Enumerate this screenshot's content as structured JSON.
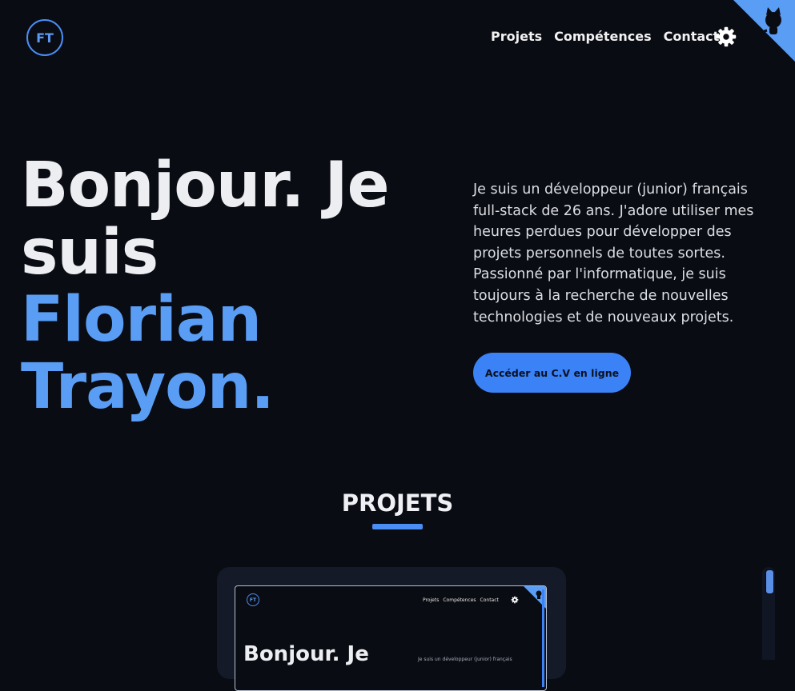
{
  "header": {
    "logo_text": "FT",
    "nav": [
      {
        "label": "Projets"
      },
      {
        "label": "Compétences"
      },
      {
        "label": "Contact"
      }
    ],
    "settings_icon": "gear-icon",
    "github_icon": "github-octocat-icon",
    "accent_color": "#3b82f6"
  },
  "hero": {
    "line1": "Bonjour. Je",
    "line2": "suis",
    "name_line1": "Florian",
    "name_line2": "Trayon.",
    "intro": "Je suis un développeur (junior) français full-stack de 26 ans. J'adore utiliser mes heures perdues pour développer des projets personnels de toutes sortes. Passionné par l'informatique, je suis toujours à la recherche de nouvelles technologies et de nouveaux projets.",
    "cv_button": "Accéder au C.V en ligne"
  },
  "projects": {
    "title": "PROJETS",
    "preview": {
      "logo_text": "FT",
      "nav": [
        "Projets",
        "Compétences",
        "Contact"
      ],
      "title": "Bonjour. Je",
      "text": "Je suis un développeur (junior) français"
    }
  }
}
